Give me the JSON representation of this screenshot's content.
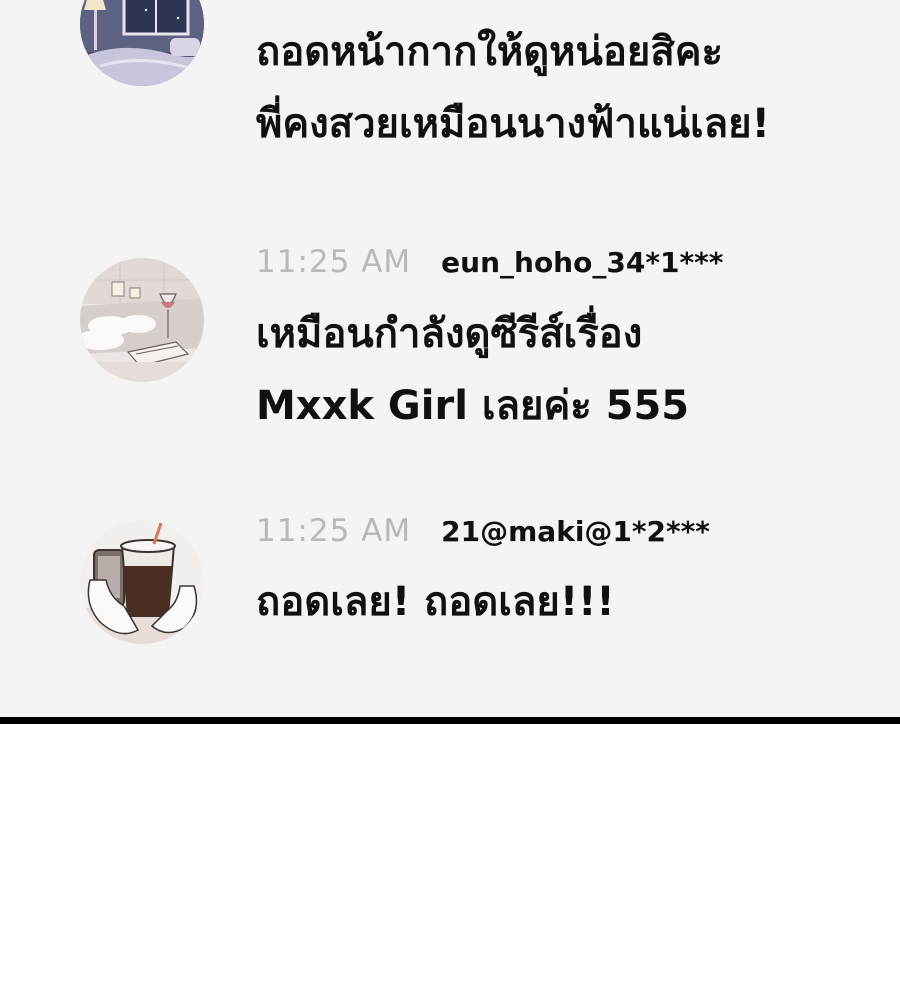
{
  "messages": [
    {
      "avatar": "night-room-avatar",
      "text_lines": [
        "ถอดหน้ากากให้ดูหน่อยสิคะ",
        "พี่คงสวยเหมือนนางฟ้าแน่เลย!"
      ]
    },
    {
      "time": "11:25 AM",
      "user": "eun_hoho_34*1***",
      "avatar": "bath-wine-avatar",
      "text_lines": [
        "เหมือนกำลังดูซีรีส์เรื่อง",
        "Mxxk Girl เลยค่ะ 555"
      ]
    },
    {
      "time": "11:25 AM",
      "user": "21@maki@1*2***",
      "avatar": "iced-coffee-avatar",
      "text_lines": [
        "ถอดเลย! ถอดเลย!!!"
      ]
    }
  ],
  "colors": {
    "panel_bg": "#f4f4f4",
    "timestamp": "#b9b9b9",
    "text": "#111111",
    "divider": "#000000"
  }
}
